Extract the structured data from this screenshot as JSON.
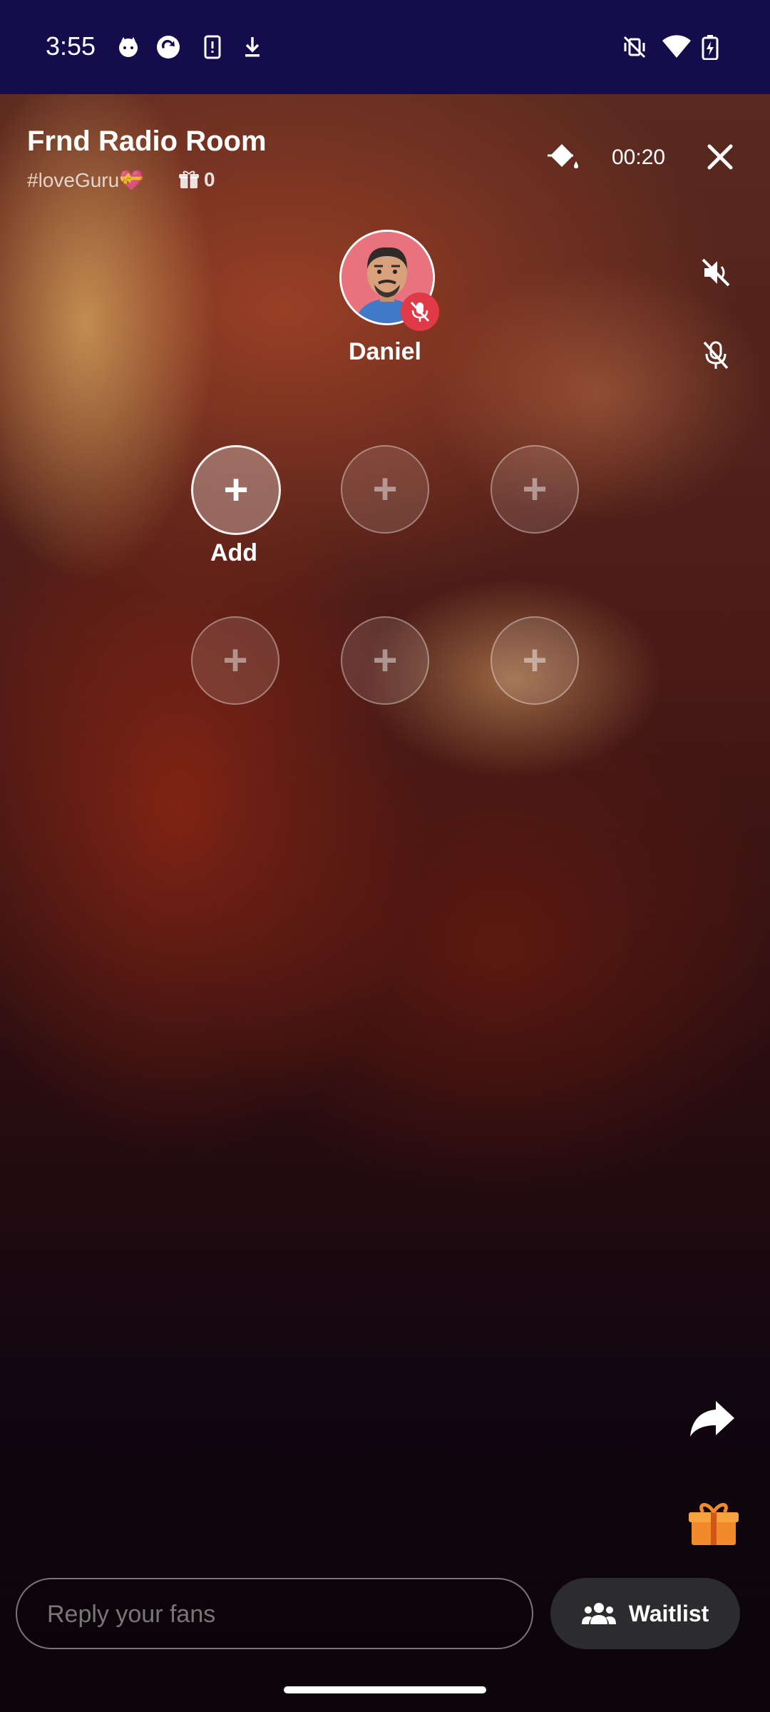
{
  "status_bar": {
    "time": "3:55",
    "left_icons": [
      "cat-face-icon",
      "sync-app-icon",
      "phone-alert-icon",
      "download-icon"
    ],
    "right_icons": [
      "vibrate-off-icon",
      "wifi-icon",
      "battery-charging-icon"
    ]
  },
  "room": {
    "title": "Frnd Radio Room",
    "tag": "#loveGuru💝",
    "gift_count": "0",
    "timer": "00:20"
  },
  "host": {
    "name": "Daniel"
  },
  "seats": {
    "add_label": "Add"
  },
  "composer": {
    "placeholder": "Reply your fans",
    "waitlist_label": "Waitlist"
  },
  "colors": {
    "status_bar": "#150c4b",
    "mic_badge": "#e03a48",
    "avatar_bg": "#e8737e",
    "gift_orange": "#f08a2a",
    "waitlist_bg": "#2c2b2e"
  }
}
